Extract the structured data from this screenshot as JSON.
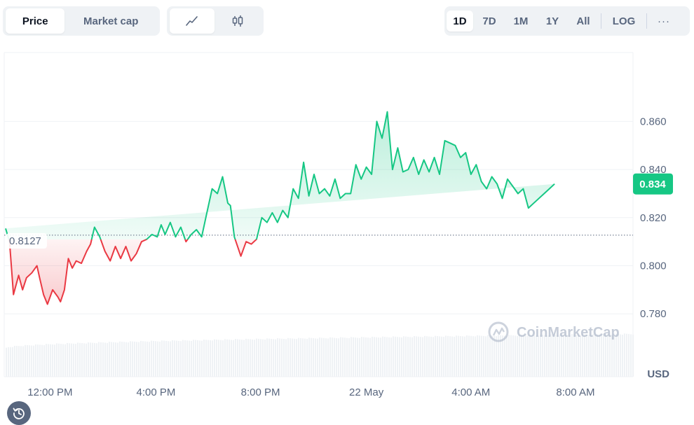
{
  "toolbar": {
    "type_tabs": [
      {
        "label": "Price",
        "active": true
      },
      {
        "label": "Market cap",
        "active": false
      }
    ],
    "view_icons": [
      "line-chart-icon",
      "candlestick-icon"
    ],
    "ranges": [
      "1D",
      "7D",
      "1M",
      "1Y",
      "All"
    ],
    "active_range": "1D",
    "log_label": "LOG",
    "more_label": "···"
  },
  "watermark": "CoinMarketCap",
  "history_icon": "history-icon",
  "chart_data": {
    "type": "area",
    "ylabel": "USD",
    "y_ticks": [
      "0.860",
      "0.840",
      "0.820",
      "0.800",
      "0.780"
    ],
    "x_ticks": [
      "12:00 PM",
      "4:00 PM",
      "8:00 PM",
      "22 May",
      "4:00 AM",
      "8:00 AM"
    ],
    "ylim": [
      0.769,
      0.877
    ],
    "baseline": {
      "value": 0.8127,
      "label": "0.8127"
    },
    "current": {
      "value": 0.834,
      "label": "0.834"
    },
    "colors": {
      "up": "#16c784",
      "down": "#ea3943"
    },
    "x_hours": [
      0.0,
      0.15,
      0.3,
      0.5,
      0.65,
      0.8,
      1.0,
      1.2,
      1.3,
      1.45,
      1.6,
      1.8,
      2.0,
      2.1,
      2.25,
      2.4,
      2.55,
      2.7,
      2.9,
      3.1,
      3.25,
      3.4,
      3.6,
      3.8,
      4.0,
      4.2,
      4.4,
      4.6,
      4.8,
      5.0,
      5.2,
      5.4,
      5.6,
      5.8,
      5.95,
      6.1,
      6.3,
      6.5,
      6.7,
      6.9,
      7.1,
      7.3,
      7.5,
      7.7,
      7.9,
      8.1,
      8.3,
      8.5,
      8.6,
      8.75,
      9.0,
      9.2,
      9.4,
      9.6,
      9.8,
      10.0,
      10.2,
      10.4,
      10.6,
      10.8,
      11.0,
      11.2,
      11.4,
      11.6,
      11.8,
      12.0,
      12.2,
      12.4,
      12.6,
      12.8,
      13.0,
      13.2,
      13.4,
      13.6,
      13.8,
      14.0,
      14.2,
      14.4,
      14.6,
      14.8,
      15.0,
      15.2,
      15.4,
      15.6,
      15.8,
      16.0,
      16.2,
      16.4,
      16.6,
      16.8,
      17.0,
      17.2,
      17.4,
      17.6,
      17.8,
      18.0,
      18.2,
      18.4,
      18.6,
      18.8,
      19.0,
      19.2,
      19.4,
      19.6,
      19.8,
      20.0,
      20.2,
      20.4,
      20.6,
      20.8,
      21.0,
      21.2,
      21.4,
      21.6,
      21.8,
      22.0,
      22.2,
      22.4,
      22.6,
      22.8,
      23.0,
      23.2,
      23.4,
      23.6,
      23.8,
      24.0
    ],
    "y": [
      0.8155,
      0.81,
      0.788,
      0.796,
      0.79,
      0.795,
      0.797,
      0.8,
      0.795,
      0.788,
      0.784,
      0.79,
      0.787,
      0.785,
      0.79,
      0.803,
      0.799,
      0.802,
      0.801,
      0.806,
      0.809,
      0.816,
      0.812,
      0.806,
      0.802,
      0.808,
      0.803,
      0.808,
      0.802,
      0.805,
      0.81,
      0.811,
      0.813,
      0.812,
      0.817,
      0.813,
      0.818,
      0.812,
      0.816,
      0.81,
      0.813,
      0.815,
      0.812,
      0.822,
      0.832,
      0.83,
      0.837,
      0.826,
      0.825,
      0.812,
      0.804,
      0.81,
      0.809,
      0.811,
      0.82,
      0.818,
      0.822,
      0.818,
      0.823,
      0.82,
      0.832,
      0.828,
      0.843,
      0.829,
      0.838,
      0.83,
      0.832,
      0.829,
      0.836,
      0.828,
      0.83,
      0.83,
      0.842,
      0.836,
      0.841,
      0.838,
      0.86,
      0.853,
      0.864,
      0.84,
      0.849,
      0.839,
      0.84,
      0.845,
      0.838,
      0.844,
      0.839,
      0.845,
      0.838,
      0.852,
      0.851,
      0.85,
      0.845,
      0.847,
      0.838,
      0.842,
      0.835,
      0.832,
      0.837,
      0.834,
      0.828,
      0.836,
      0.833,
      0.83,
      0.832,
      0.824,
      0.826,
      0.828,
      0.83,
      0.832,
      0.834
    ],
    "grid": true
  }
}
